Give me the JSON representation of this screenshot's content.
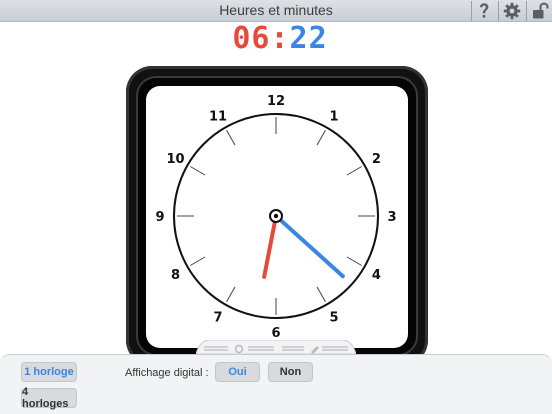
{
  "window": {
    "title": "Heures et minutes"
  },
  "toolbar": {
    "help_icon": "question-mark-icon",
    "settings_icon": "gear-icon",
    "lock_icon": "unlocked-padlock-icon"
  },
  "digital_display": {
    "hours": "06",
    "separator": ":",
    "minutes": "22"
  },
  "clock": {
    "numbers": [
      "12",
      "1",
      "2",
      "3",
      "4",
      "5",
      "6",
      "7",
      "8",
      "9",
      "10",
      "11"
    ],
    "hour_value": 6.3667,
    "minute_value": 22,
    "colors": {
      "hour_hand": "#e64a3b",
      "minute_hand": "#3a86e6",
      "face": "#ffffff",
      "frame": "#111111"
    }
  },
  "panel": {
    "one_clock_label": "1 horloge",
    "four_clocks_label": "4 horloges",
    "digital_label": "Affichage digital :",
    "yes_label": "Oui",
    "no_label": "Non"
  }
}
